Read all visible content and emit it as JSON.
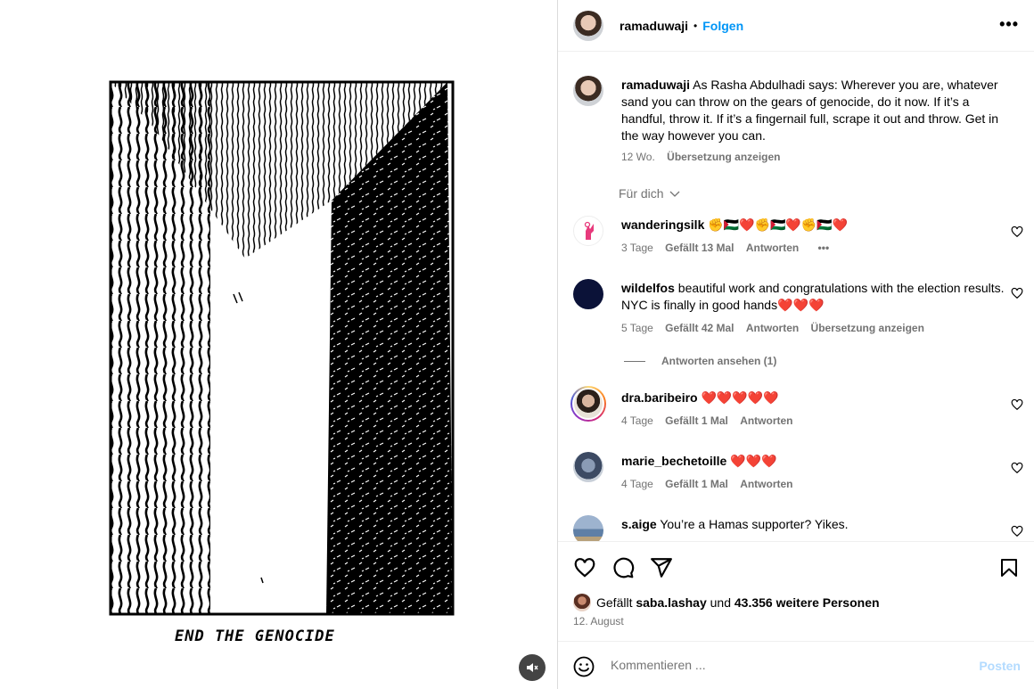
{
  "post": {
    "username": "ramaduwaji",
    "follow_label": "Folgen",
    "separator": "•",
    "more_label": "•••",
    "artwork_caption": "END THE GENOCIDE"
  },
  "caption": {
    "username": "ramaduwaji",
    "text": "As Rasha Abdulhadi says: Wherever you are, whatever sand you can throw on the gears of genocide, do it now. If it’s a handful, throw it. If it’s a fingernail full, scrape it out and throw. Get in the way however you can.",
    "age": "12 Wo.",
    "translate": "Übersetzung anzeigen"
  },
  "sort_label": "Für dich",
  "comments": [
    {
      "username": "wanderingsilk",
      "text": "✊🇵🇸❤️✊🇵🇸❤️✊🇵🇸❤️",
      "age": "3 Tage",
      "likes": "Gefällt 13 Mal",
      "reply": "Antworten",
      "extra": "•••"
    },
    {
      "username": "wildelfos",
      "text": "beautiful work and congratulations with the election results. NYC is finally in good hands❤️❤️❤️",
      "age": "5 Tage",
      "likes": "Gefällt 42 Mal",
      "reply": "Antworten",
      "extra": "Übersetzung anzeigen",
      "view_replies": "Antworten ansehen (1)"
    },
    {
      "username": "dra.baribeiro",
      "text": "❤️❤️❤️❤️❤️",
      "age": "4 Tage",
      "likes": "Gefällt 1 Mal",
      "reply": "Antworten"
    },
    {
      "username": "marie_bechetoille",
      "text": "❤️❤️❤️",
      "age": "4 Tage",
      "likes": "Gefällt 1 Mal",
      "reply": "Antworten"
    },
    {
      "username": "s.aige",
      "text": "You’re a Hamas supporter? Yikes."
    }
  ],
  "likes": {
    "prefix": "Gefällt",
    "user": "saba.lashay",
    "middle": "und",
    "others": "43.356 weitere Personen"
  },
  "date": "12. August",
  "comment_box": {
    "placeholder": "Kommentieren ...",
    "post_label": "Posten"
  },
  "icons": [
    "heart-icon",
    "comment-icon",
    "share-icon",
    "bookmark-icon",
    "emoji-icon",
    "mute-icon"
  ]
}
